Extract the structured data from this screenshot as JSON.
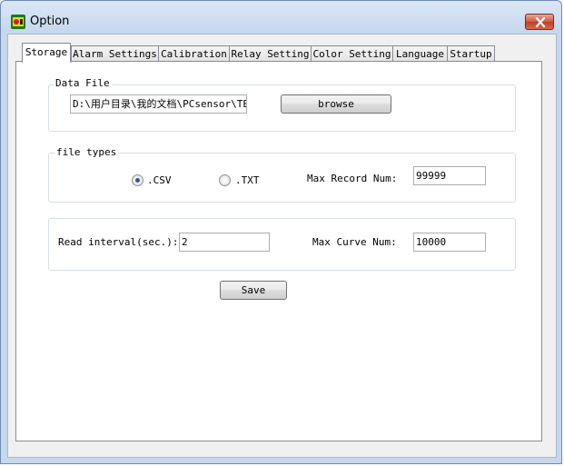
{
  "window": {
    "title": "Option",
    "close_icon": "close-icon"
  },
  "tabs": [
    {
      "label": "Storage",
      "active": true
    },
    {
      "label": "Alarm Settings",
      "active": false
    },
    {
      "label": "Calibration",
      "active": false
    },
    {
      "label": "Relay Setting",
      "active": false
    },
    {
      "label": "Color Setting",
      "active": false
    },
    {
      "label": "Language",
      "active": false
    },
    {
      "label": "Startup",
      "active": false
    }
  ],
  "storage": {
    "data_file": {
      "legend": "Data File",
      "path": "D:\\用户目录\\我的文档\\PCsensor\\TE",
      "browse_label": "browse"
    },
    "file_types": {
      "legend": "file types",
      "options": [
        {
          "label": ".CSV",
          "checked": true
        },
        {
          "label": ".TXT",
          "checked": false
        }
      ],
      "max_record_label": "Max Record Num:",
      "max_record_value": "99999"
    },
    "interval": {
      "read_interval_label": "Read interval(sec.):",
      "read_interval_value": "2",
      "max_curve_label": "Max Curve Num:",
      "max_curve_value": "10000"
    },
    "save_label": "Save"
  }
}
